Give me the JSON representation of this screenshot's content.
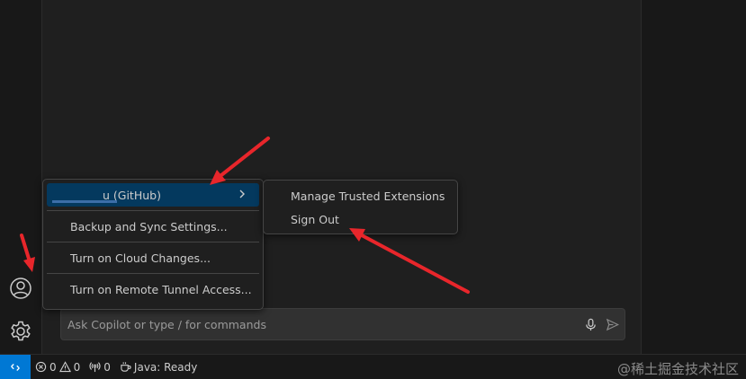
{
  "account_menu": {
    "account_label": "u (GitHub)",
    "items": [
      "Backup and Sync Settings...",
      "Turn on Cloud Changes...",
      "Turn on Remote Tunnel Access..."
    ]
  },
  "submenu": {
    "items": [
      "Manage Trusted Extensions",
      "Sign Out"
    ]
  },
  "chat": {
    "placeholder": "Ask Copilot or type / for commands"
  },
  "status_bar": {
    "errors": "0",
    "warnings": "0",
    "ports": "0",
    "java_status": "Java: Ready"
  },
  "watermark": "@稀土掘金技术社区",
  "colors": {
    "accent": "#0078d4",
    "menu_highlight": "#04395e",
    "annotation_arrow": "#e8262b"
  }
}
